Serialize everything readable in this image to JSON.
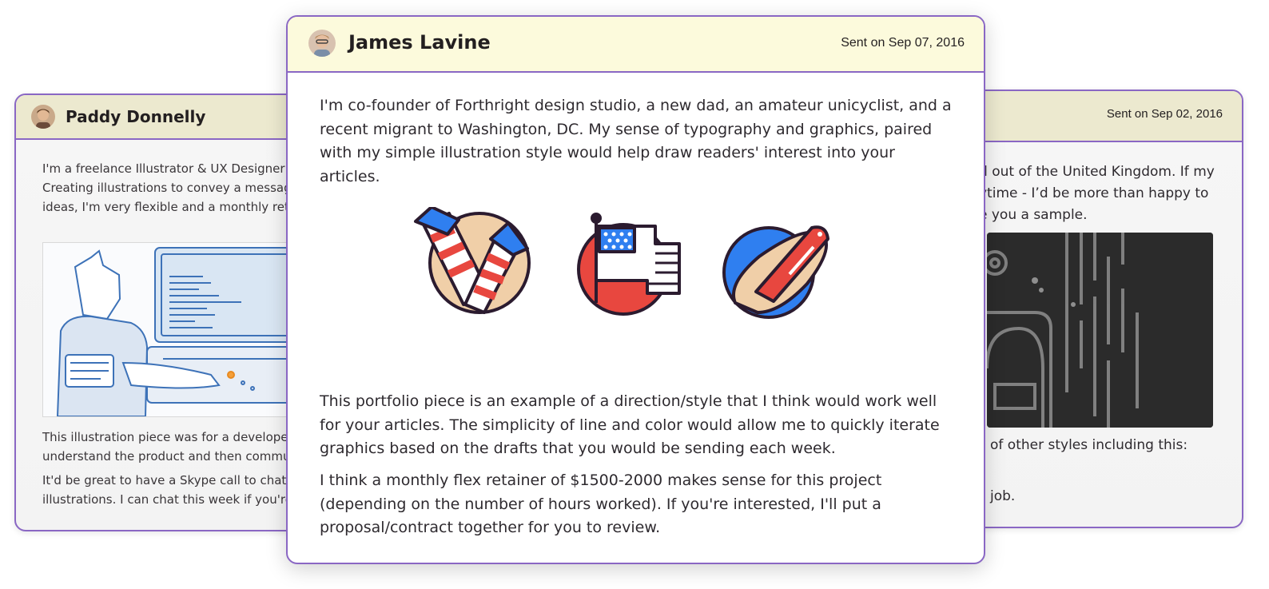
{
  "cards": {
    "left": {
      "sender": "Paddy Donnelly",
      "intro_lines": [
        "I'm a freelance Illustrator & UX Designer at",
        "Creating illustrations to convey a message",
        "ideas, I'm very flexible and a monthly retai"
      ],
      "body_lines": [
        "This illustration piece was for a developer-",
        "understand the product and then commun",
        "It'd be great to have a Skype call to chat ab",
        "illustrations. I can chat this week if you're f"
      ]
    },
    "main": {
      "sender": "James Lavine",
      "sent": "Sent on Sep 07, 2016",
      "paragraphs": [
        "I'm co-founder of Forthright design studio, a new dad, an amateur unicyclist, and a recent migrant to Washington, DC. My sense of typography and graphics, paired with my simple illustration style would help draw readers' interest into your articles.",
        "This portfolio piece is an example of a direction/style that I think would work well for your articles. The simplicity of line and color would allow me to quickly iterate graphics based on the drafts that you would be sending each week.",
        "I think a monthly flex retainer of $1500-2000 makes sense for this project (depending on the number of hours worked). If you're interested, I'll put a proposal/contract together for you to review."
      ],
      "icons": [
        "fireworks-icon",
        "american-flag-icon",
        "hotdog-icon"
      ]
    },
    "right": {
      "sent": "Sent on Sep 02, 2016",
      "intro_lines": [
        "d out of the United Kingdom. If my",
        "ytime - I’d be more than happy to",
        "e you a sample."
      ],
      "line_styles": "of other styles including this:",
      "line_job": "job."
    }
  },
  "colors": {
    "border": "#8a67c4",
    "main_header_bg": "#fcfadc",
    "side_header_bg": "#ece9cf",
    "icon_red": "#e8473f",
    "icon_blue": "#2f7ff0",
    "icon_tan": "#f0cfa8",
    "icon_outline": "#2b1b2f"
  }
}
